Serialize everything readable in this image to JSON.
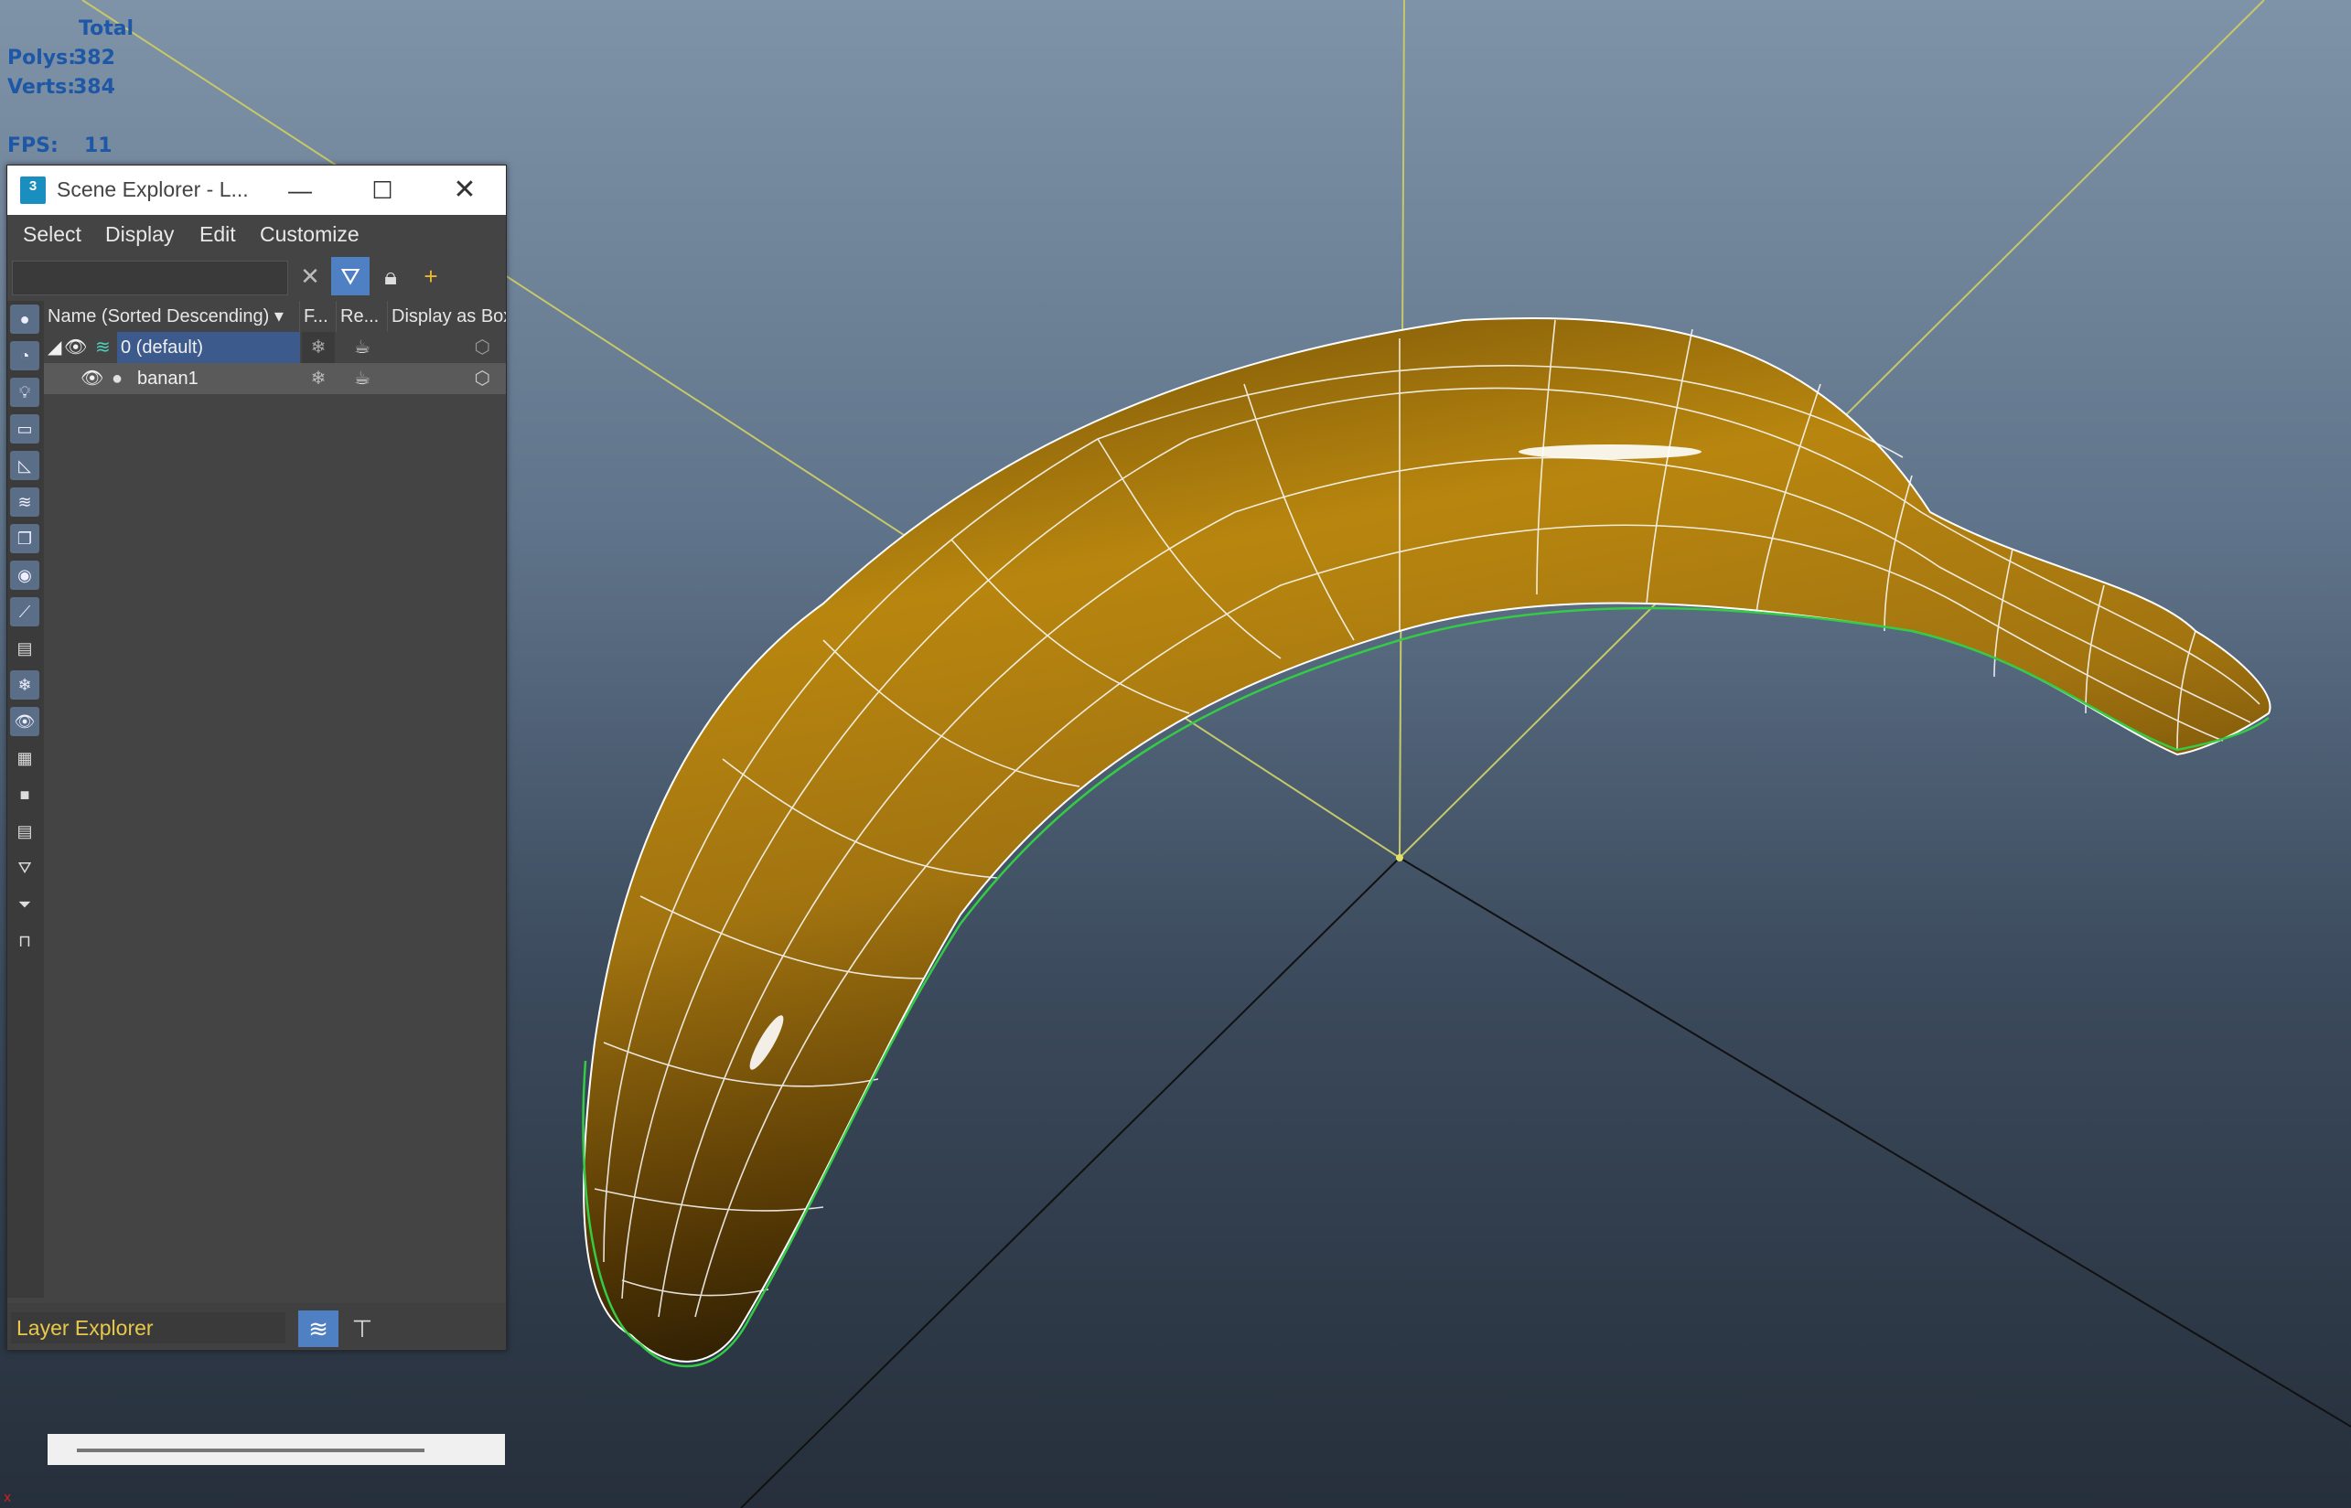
{
  "stats": {
    "total_label": "Total",
    "polys_label": "Polys:",
    "polys_value": "382",
    "verts_label": "Verts:",
    "verts_value": "384",
    "fps_label": "FPS:",
    "fps_value": "11"
  },
  "explorer": {
    "app_icon": "3",
    "title": "Scene Explorer - L...",
    "menus": [
      "Select",
      "Display",
      "Edit",
      "Customize"
    ],
    "columns": {
      "name": "Name (Sorted Descending)",
      "frozen": "F...",
      "render": "Re...",
      "box": "Display as Box"
    },
    "rows": [
      {
        "name": "0 (default)",
        "type": "layer",
        "selected": true
      },
      {
        "name": "banan1",
        "type": "object",
        "selected": false
      }
    ],
    "bottom": {
      "explorer_type": "Layer Explorer"
    }
  },
  "viewport": {
    "axis_indicator": "x"
  },
  "colors": {
    "stats_text": "#1d57a6",
    "selection": "#3d5a8c",
    "layer_text": "#e8c84a",
    "wireframe": "#ffffff",
    "selection_edge": "#33cc44",
    "banana": "#9a6a0c"
  },
  "icons": {
    "clear_search": "close-icon",
    "filter": "filter-icon",
    "lock": "lock-icon",
    "add_layer": "add-layer-icon",
    "visibility": "eye-icon",
    "freeze": "snowflake-icon",
    "render": "teapot-icon",
    "box": "box-icon"
  }
}
